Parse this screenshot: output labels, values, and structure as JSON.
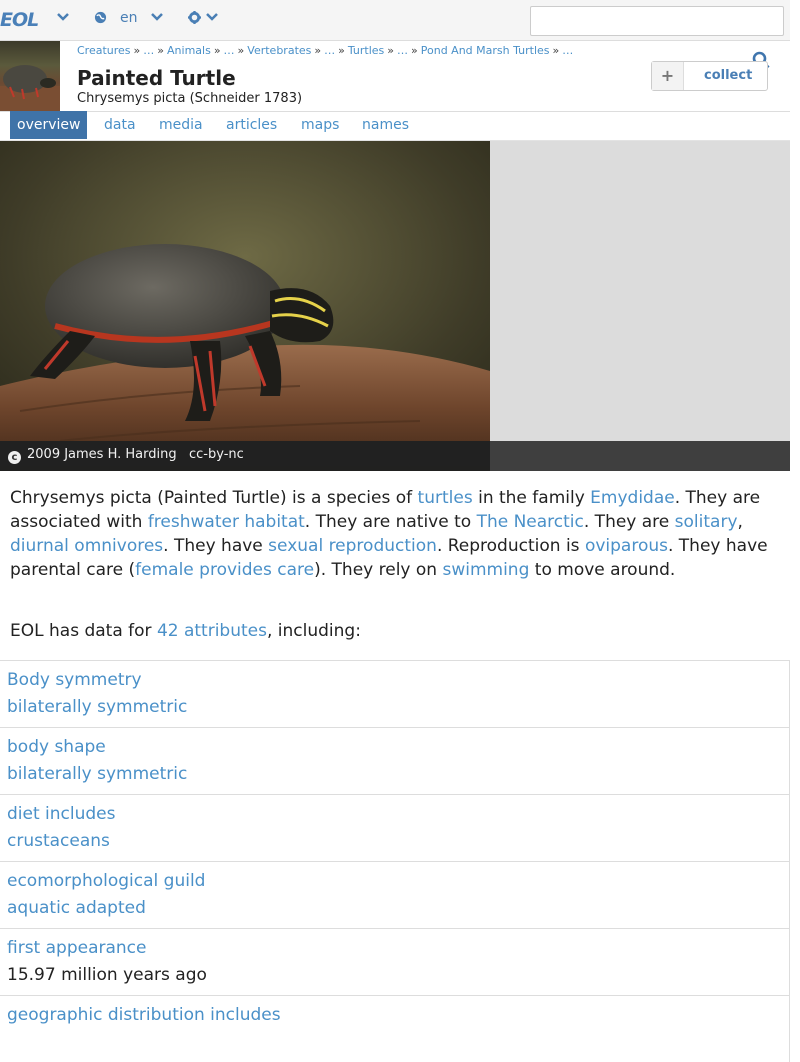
{
  "topbar": {
    "logo_text": "EOL",
    "language": "en",
    "search_placeholder": "",
    "icons": [
      "chevron-down-icon",
      "globe-icon",
      "chevron-down-icon",
      "gear-icon",
      "chevron-down-icon"
    ]
  },
  "header": {
    "breadcrumb": [
      "Creatures",
      "…",
      "Animals",
      "…",
      "Vertebrates",
      "…",
      "Turtles",
      "…",
      "Pond And Marsh Turtles",
      "…"
    ],
    "title": "Painted Turtle",
    "scientific_name": "Chrysemys picta (Schneider 1783)",
    "collect_label": "collect",
    "collect_icon": "plus-icon",
    "search_icon": "search-icon"
  },
  "tabs": [
    "overview",
    "data",
    "media",
    "articles",
    "maps",
    "names"
  ],
  "active_tab": "overview",
  "hero": {
    "caption_year_author": "2009 James H. Harding",
    "caption_license": "cc-by-nc",
    "copyright_icon": "copyright-icon"
  },
  "summary": {
    "s1": "Chrysemys picta (Painted Turtle) is a species of ",
    "l_turtles": "turtles",
    "s2": " in the family ",
    "l_family": "Emydidae",
    "s3": ". They are associated with ",
    "l_habitat": "freshwater habitat",
    "s4": ". They are native to ",
    "l_native": "The Nearctic",
    "s5": ". They are ",
    "l_solitary": "solitary",
    "s6": ", ",
    "l_diurnal": "diurnal omnivores",
    "s7": ". They have ",
    "l_repro": "sexual reproduction",
    "s8": ". Reproduction is ",
    "l_ovi": "oviparous",
    "s9": ". They have parental care (",
    "l_care": "female provides care",
    "s10": "). They rely on ",
    "l_swim": "swimming",
    "s11": " to move around."
  },
  "attributes_line": {
    "prefix": "EOL has data for ",
    "link": "42 attributes",
    "suffix": ", including:"
  },
  "data_rows": [
    {
      "key": "Body symmetry",
      "value": "bilaterally symmetric",
      "value_is_link": true
    },
    {
      "key": "body shape",
      "value": "bilaterally symmetric",
      "value_is_link": true
    },
    {
      "key": "diet includes",
      "value": "crustaceans",
      "value_is_link": true
    },
    {
      "key": "ecomorphological guild",
      "value": "aquatic adapted",
      "value_is_link": true
    },
    {
      "key": "first appearance",
      "value": "15.97 million years ago",
      "value_is_link": false
    },
    {
      "key": "geographic distribution includes",
      "value": "",
      "value_is_link": true
    }
  ]
}
